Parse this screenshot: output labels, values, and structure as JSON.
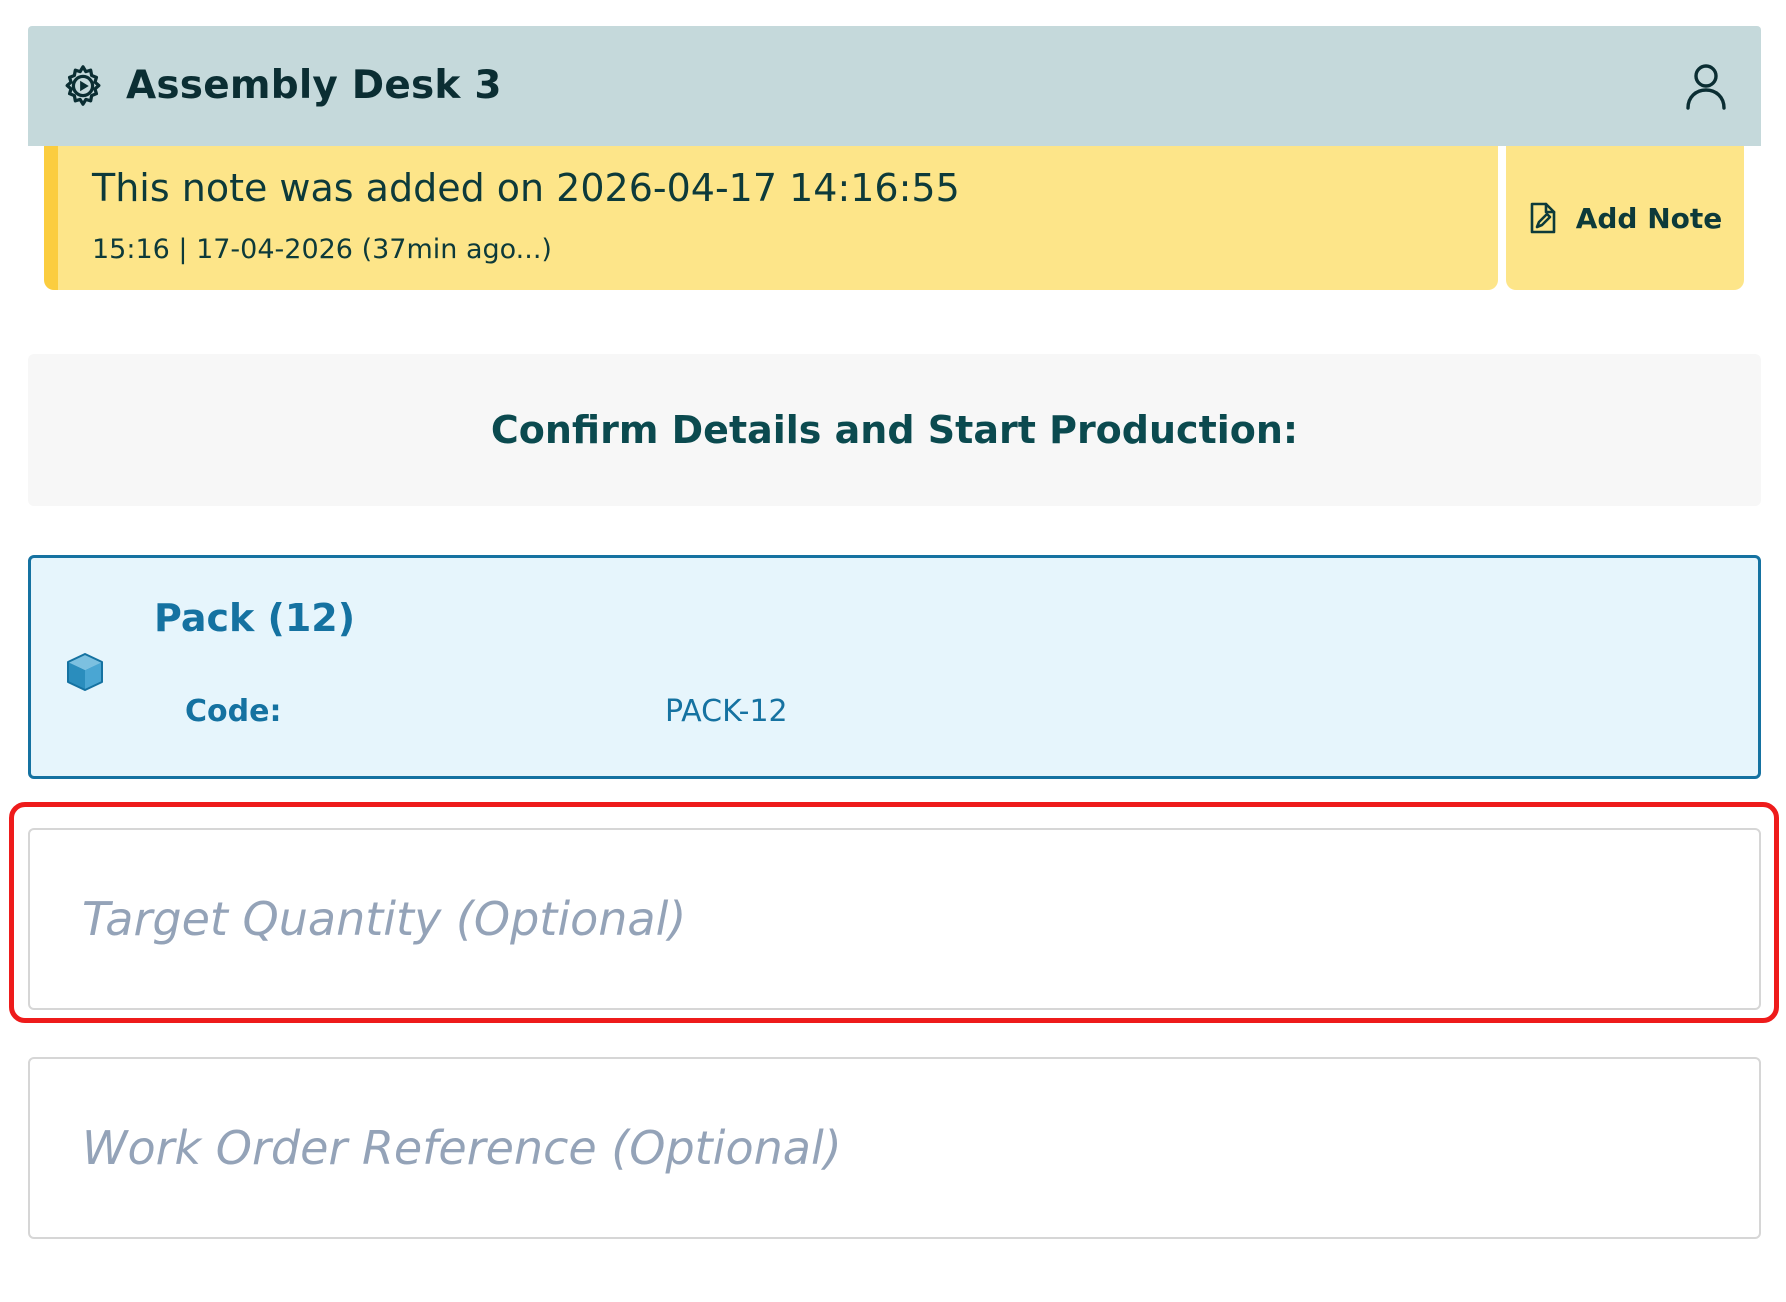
{
  "header": {
    "title": "Assembly Desk 3",
    "icons": {
      "left": "gear-play-icon",
      "right": "user-icon"
    },
    "background": "#c5d9db"
  },
  "note": {
    "text": "This note was added on 2026-04-17 14:16:55",
    "meta": "15:16 | 17-04-2026 (37min ago...)",
    "background": "#fde589",
    "accent": "#fbcd3f"
  },
  "add_note": {
    "label": "Add Note",
    "icon": "note-edit-icon"
  },
  "section": {
    "heading": "Confirm Details and Start Production:"
  },
  "product": {
    "name": "Pack (12)",
    "code_label": "Code:",
    "code_value": "PACK-12",
    "icon": "box-icon",
    "accent": "#1572a1",
    "background": "#e6f5fc"
  },
  "form": {
    "target_quantity": {
      "placeholder": "Target Quantity (Optional)",
      "value": ""
    },
    "work_order": {
      "placeholder": "Work Order Reference (Optional)",
      "value": ""
    }
  },
  "highlight_color": "#ee1b1b"
}
